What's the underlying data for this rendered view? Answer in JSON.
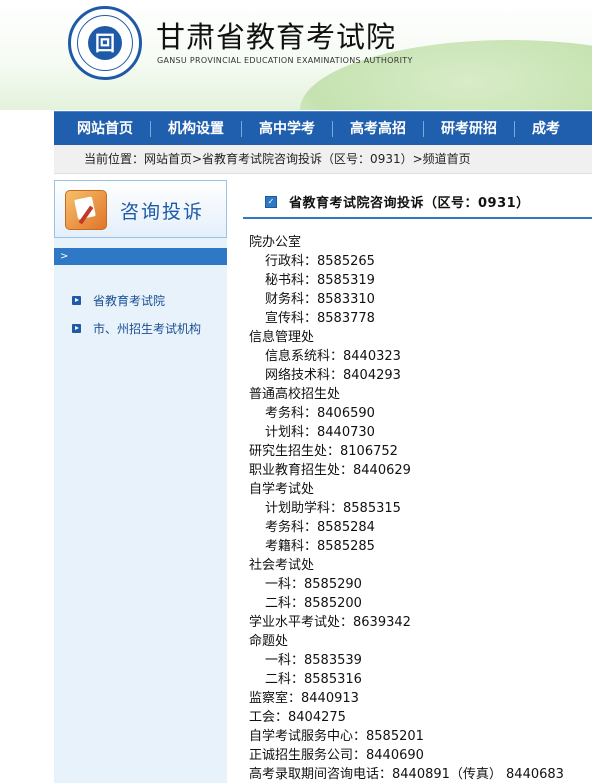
{
  "header": {
    "logo_center": "回",
    "site_title": "甘肃省教育考试院",
    "site_subtitle": "GANSU PROVINCIAL EDUCATION EXAMINATIONS AUTHORITY"
  },
  "nav": {
    "items": [
      "网站首页",
      "机构设置",
      "高中学考",
      "高考高招",
      "研考研招",
      "成考"
    ]
  },
  "breadcrumb": "当前位置：网站首页>省教育考试院咨询投诉（区号：0931）>频道首页",
  "sidebar": {
    "title": "咨询投诉",
    "bar_arrow": ">",
    "items": [
      "省教育考试院",
      "市、州招生考试机构"
    ]
  },
  "main": {
    "title": "省教育考试院咨询投诉（区号：0931）",
    "checkbox_mark": "✓",
    "entries": [
      {
        "text": "院办公室",
        "level": 0
      },
      {
        "text": "行政科：8585265",
        "level": 1
      },
      {
        "text": "秘书科：8585319",
        "level": 1
      },
      {
        "text": "财务科：8583310",
        "level": 1
      },
      {
        "text": "宣传科：8583778",
        "level": 1
      },
      {
        "text": "信息管理处",
        "level": 0
      },
      {
        "text": "信息系统科：8440323",
        "level": 1
      },
      {
        "text": "网络技术科：8404293",
        "level": 1
      },
      {
        "text": "普通高校招生处",
        "level": 0
      },
      {
        "text": "考务科：8406590",
        "level": 1
      },
      {
        "text": "计划科：8440730",
        "level": 1
      },
      {
        "text": "研究生招生处：8106752",
        "level": 0
      },
      {
        "text": "职业教育招生处：8440629",
        "level": 0
      },
      {
        "text": "自学考试处",
        "level": 0
      },
      {
        "text": "计划助学科：8585315",
        "level": 1
      },
      {
        "text": "考务科：8585284",
        "level": 1
      },
      {
        "text": "考籍科：8585285",
        "level": 1
      },
      {
        "text": "社会考试处",
        "level": 0
      },
      {
        "text": "一科：8585290",
        "level": 1
      },
      {
        "text": "二科：8585200",
        "level": 1
      },
      {
        "text": "学业水平考试处：8639342",
        "level": 0
      },
      {
        "text": "命题处",
        "level": 0
      },
      {
        "text": "一科：8583539",
        "level": 1
      },
      {
        "text": "二科：8585316",
        "level": 1
      },
      {
        "text": "监察室：8440913",
        "level": 0
      },
      {
        "text": "工会：8404275",
        "level": 0
      },
      {
        "text": "自学考试服务中心：8585201",
        "level": 0
      },
      {
        "text": "正诚招生服务公司：8440690",
        "level": 0
      },
      {
        "text": "高考录取期间咨询电话：8440891（传真） 8440683",
        "level": 0
      }
    ]
  },
  "colors": {
    "nav_bg": "#1f5fae",
    "accent": "#2e78c5",
    "sidebar_bg": "#e8f2fb",
    "link": "#1a4f93"
  }
}
